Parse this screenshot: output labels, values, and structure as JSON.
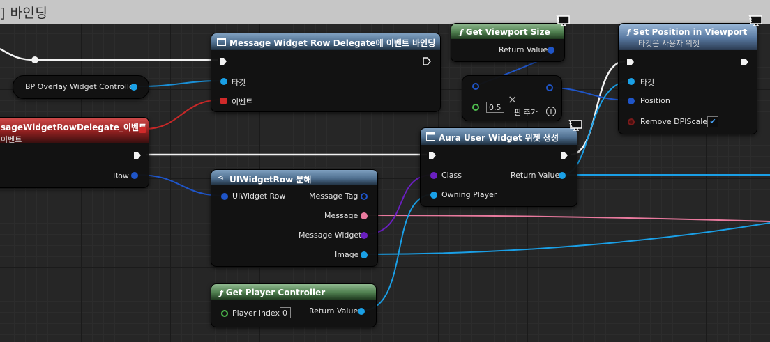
{
  "title": "] 바인딩",
  "nodes": {
    "bind": {
      "title": "Message Widget Row Delegate에 이벤트 바인딩",
      "target": "타깃",
      "event": "이벤트"
    },
    "bp_controller": {
      "label": "BP Overlay Widget Controller"
    },
    "event_node": {
      "title": "sageWidgetRowDelegate_이벤트",
      "subtitle": "이벤트",
      "row": "Row"
    },
    "viewport_size": {
      "title": "Get Viewport Size",
      "return": "Return Value"
    },
    "divide": {
      "value": "0.5",
      "add_pin": "핀 추가"
    },
    "set_position": {
      "title": "Set Position in Viewport",
      "subtitle": "타깃은 사용자 위젯",
      "target": "타깃",
      "position": "Position",
      "remove_dpi": "Remove DPIScale",
      "remove_dpi_checked": true
    },
    "create_widget": {
      "title": "Aura User Widget 위젯 생성",
      "class": "Class",
      "owning_player": "Owning Player",
      "return": "Return Value"
    },
    "break_row": {
      "title": "UIWidgetRow 분해",
      "input": "UIWidget Row",
      "message_tag": "Message Tag",
      "message": "Message",
      "message_widget": "Message Widget",
      "image": "Image"
    },
    "player_controller": {
      "title": "Get Player Controller",
      "player_index": "Player Index",
      "index_value": "0",
      "return": "Return Value"
    }
  }
}
